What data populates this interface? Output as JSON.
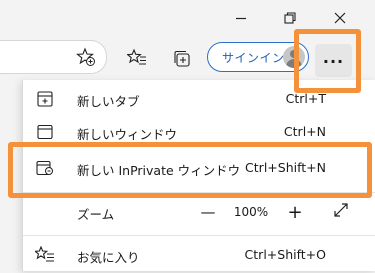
{
  "window_controls": [
    "minimize-icon",
    "restore-icon",
    "close-icon"
  ],
  "toolbar": {
    "icons": [
      "add-to-favorites-icon",
      "favorites-icon",
      "collections-icon"
    ],
    "signin_label": "サインイン",
    "more_label": "..."
  },
  "menu": {
    "items": [
      {
        "icon": "new-tab-icon",
        "label": "新しいタブ",
        "shortcut": "Ctrl+T"
      },
      {
        "icon": "new-window-icon",
        "label": "新しいウィンドウ",
        "shortcut": "Ctrl+N"
      },
      {
        "icon": "inprivate-window-icon",
        "label": "新しい InPrivate ウィンドウ",
        "shortcut": "Ctrl+Shift+N"
      }
    ],
    "zoom": {
      "label": "ズーム",
      "minus": "—",
      "value": "100%",
      "plus": "+",
      "fullscreen_icon": "expand-icon"
    },
    "favorites": {
      "icon": "favorites-icon",
      "label": "お気に入り",
      "shortcut": "Ctrl+Shift+O"
    }
  },
  "colors": {
    "highlight": "#f4913a",
    "signin_border": "#2a6fc9",
    "signin_text": "#1f5fb8"
  }
}
